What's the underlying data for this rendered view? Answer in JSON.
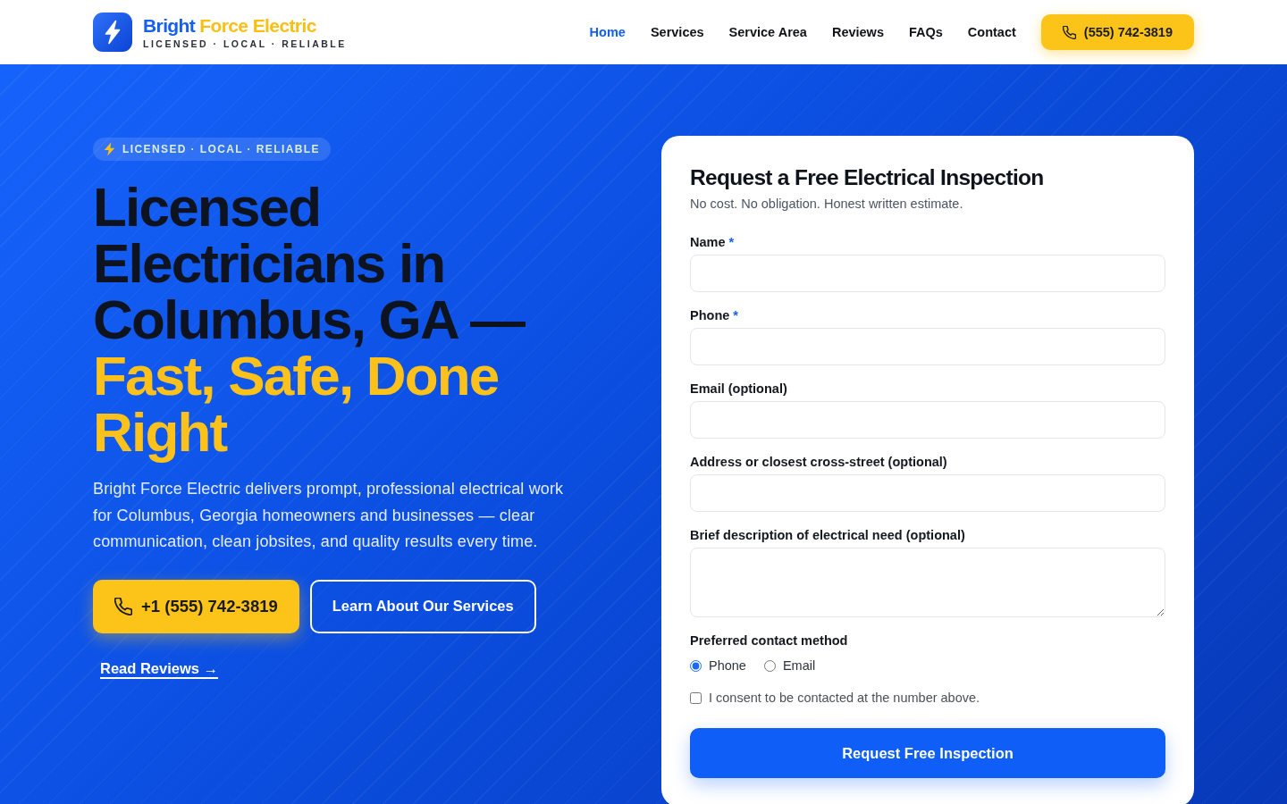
{
  "header": {
    "brand": {
      "name": "Bright",
      "name_accent": "Force Electric",
      "tagline": "LICENSED · LOCAL · RELIABLE"
    },
    "nav": [
      {
        "label": "Home",
        "selected": true
      },
      {
        "label": "Services",
        "selected": false
      },
      {
        "label": "Service Area",
        "selected": false
      },
      {
        "label": "Reviews",
        "selected": false
      },
      {
        "label": "FAQs",
        "selected": false
      },
      {
        "label": "Contact",
        "selected": false
      }
    ],
    "call_button": "(555) 742-3819"
  },
  "hero": {
    "badge": "LICENSED · LOCAL · RELIABLE",
    "headline": "Licensed Electricians in Columbus, GA —",
    "headline_highlight": "Fast, Safe, Done Right",
    "intro": "Bright Force Electric delivers prompt, professional electrical work for Columbus, Georgia homeowners and businesses — clear communication, clean jobsites, and quality results every time.",
    "actions": [
      {
        "kind": "call",
        "label": "+1 (555) 742-3819"
      },
      {
        "kind": "outline",
        "label": "Learn About Our Services"
      }
    ],
    "reviews_link": "Read Reviews →"
  },
  "form": {
    "title": "Request a Free Electrical Inspection",
    "subtitle": "No cost. No obligation. Honest written estimate.",
    "fields": [
      {
        "kind": "input",
        "label": "Name",
        "required_mark": "*"
      },
      {
        "kind": "input",
        "label": "Phone",
        "required_mark": "*"
      },
      {
        "kind": "input",
        "label": "Email (optional)"
      },
      {
        "kind": "input",
        "label": "Address or closest cross-street (optional)"
      },
      {
        "kind": "textarea",
        "label": "Brief description of electrical need (optional)"
      }
    ],
    "contact_method": {
      "label": "Preferred contact method",
      "options": [
        {
          "label": "Phone",
          "selected": true
        },
        {
          "label": "Email",
          "selected": false
        }
      ]
    },
    "consent": {
      "label": "I consent to be contacted at the number above.",
      "checked": false
    },
    "submit": "Request Free Inspection"
  }
}
